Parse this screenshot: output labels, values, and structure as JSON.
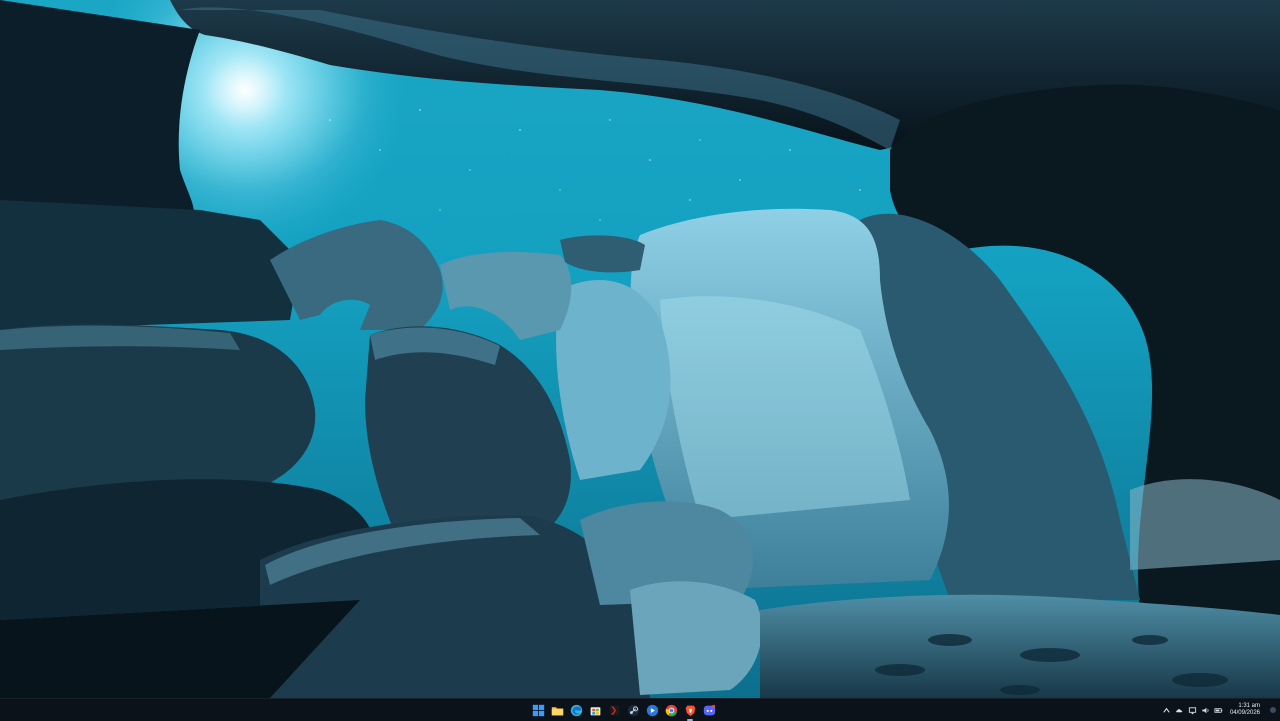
{
  "desktop": {
    "wallpaper": "cave-at-night-wallpaper"
  },
  "taskbar": {
    "apps": [
      {
        "name": "start-button",
        "icon": "windows-icon",
        "color": "#3a9bff"
      },
      {
        "name": "file-explorer-button",
        "icon": "folder-icon",
        "color": "#f4c542"
      },
      {
        "name": "edge-button",
        "icon": "edge-icon",
        "color": "#2fb6d6"
      },
      {
        "name": "store-button",
        "icon": "store-icon",
        "color": "#e8e8e8"
      },
      {
        "name": "app-red-button",
        "icon": "red-app-icon",
        "color": "#d8262f"
      },
      {
        "name": "steam-button",
        "icon": "steam-icon",
        "color": "#c7d5e0"
      },
      {
        "name": "app-blue-button",
        "icon": "blue-app-icon",
        "color": "#2a77e0"
      },
      {
        "name": "chrome-button",
        "icon": "chrome-icon",
        "color": "#e94235"
      },
      {
        "name": "brave-button",
        "icon": "brave-icon",
        "color": "#fb542b"
      },
      {
        "name": "discord-button",
        "icon": "discord-icon",
        "color": "#5865f2"
      }
    ]
  },
  "tray": {
    "time": "1:31 am",
    "date": "04/09/2026"
  }
}
